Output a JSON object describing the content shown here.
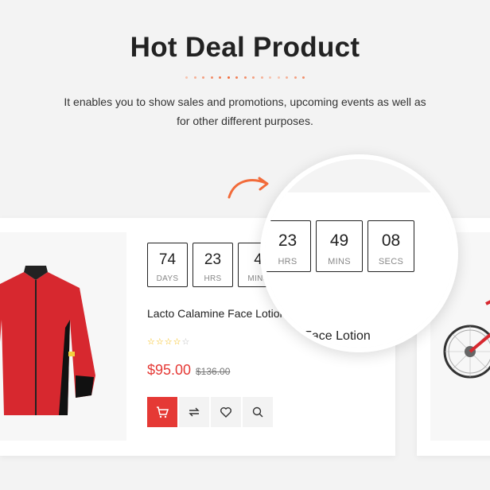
{
  "header": {
    "title": "Hot Deal Product",
    "description_line1": "It enables you to show sales and promotions, upcoming events as well as",
    "description_line2": "for other different purposes."
  },
  "colors": {
    "accent": "#f26b3a",
    "price": "#e53935",
    "cart_button": "#e53935"
  },
  "product": {
    "name": "Lacto Calamine Face Lotion",
    "rating": 4,
    "rating_max": 5,
    "price": "$95.00",
    "old_price": "$136.00",
    "countdown": [
      {
        "value": "74",
        "label": "DAYS"
      },
      {
        "value": "23",
        "label": "HRS"
      },
      {
        "value": "4",
        "label": "MINS"
      }
    ],
    "actions": [
      "cart-icon",
      "compare-icon",
      "heart-icon",
      "search-icon"
    ]
  },
  "magnifier": {
    "countdown": [
      {
        "value": "23",
        "label": "HRS"
      },
      {
        "value": "49",
        "label": "MINS"
      },
      {
        "value": "08",
        "label": "SECS"
      }
    ],
    "name_fragment": "mine Face Lotion"
  }
}
